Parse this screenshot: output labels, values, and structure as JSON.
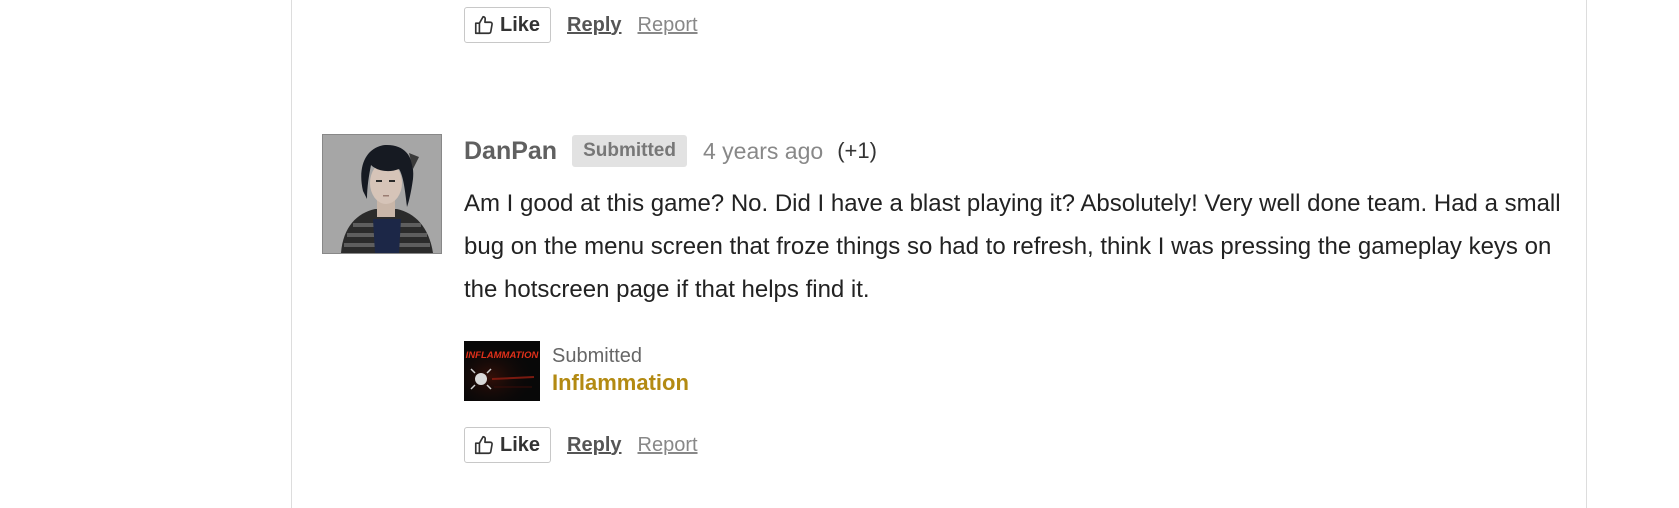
{
  "top_actions": {
    "like_label": "Like",
    "reply_label": "Reply",
    "report_label": "Report"
  },
  "comment": {
    "author": "DanPan",
    "badge": "Submitted",
    "time": "4 years ago",
    "score": "(+1)",
    "body": "Am I good at this game? No. Did I have a blast playing it? Absolutely! Very well done team. Had a small bug on the menu screen that froze things so had to refresh, think I was pressing the gameplay keys on the hotscreen page if that helps find it.",
    "submission": {
      "label": "Submitted",
      "game_title": "Inflammation",
      "thumbnail_text": "INFLAMMATION"
    },
    "actions": {
      "like_label": "Like",
      "reply_label": "Reply",
      "report_label": "Report"
    }
  },
  "colors": {
    "game_link": "#b38a12",
    "badge_bg": "#e2e2e2",
    "thumb_title": "#e0301a"
  }
}
